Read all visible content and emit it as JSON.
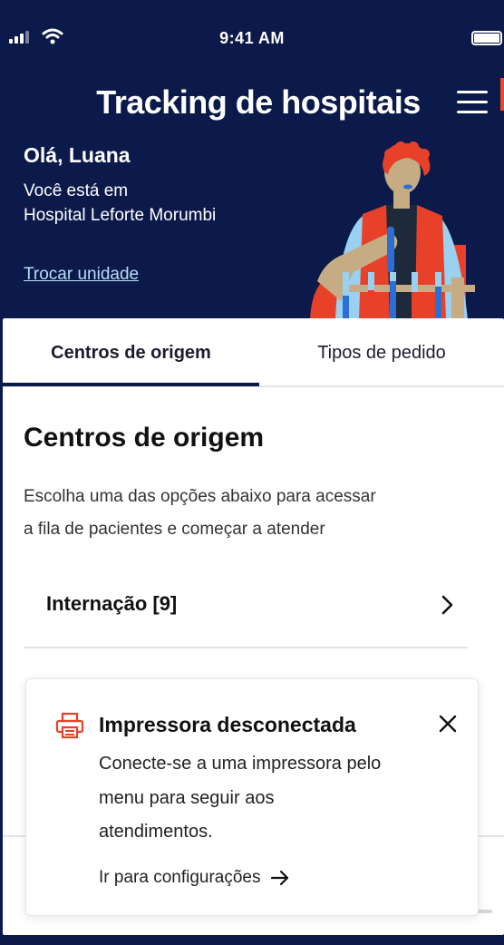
{
  "status_bar": {
    "time": "9:41 AM"
  },
  "header": {
    "title": "Tracking de hospitais",
    "greeting": "Olá, Luana",
    "location_line1": "Você está em",
    "location_line2": "Hospital Leforte Morumbi",
    "switch_link": "Trocar unidade"
  },
  "tabs": [
    {
      "label": "Centros de origem",
      "active": true
    },
    {
      "label": "Tipos de pedido",
      "active": false
    }
  ],
  "main": {
    "section_title": "Centros de origem",
    "description_line1": "Escolha uma das opções abaixo para acessar",
    "description_line2": "a fila de pacientes e começar a atender",
    "items": [
      {
        "label": "Internação [9]"
      }
    ]
  },
  "alert": {
    "title": "Impressora desconectada",
    "line1": "Conecte-se a uma impressora pelo",
    "line2": "menu para seguir aos",
    "line3": "atendimentos.",
    "link": "Ir para configurações"
  },
  "colors": {
    "header_bg": "#0b1a4a",
    "accent": "#e84a2a",
    "link": "#b8ddf5",
    "tab_indicator": "#0b1a4a"
  },
  "icons": [
    "signal-icon",
    "wifi-icon",
    "battery-icon",
    "menu-icon",
    "chevron-right-icon",
    "printer-icon",
    "close-icon",
    "arrow-right-icon"
  ]
}
